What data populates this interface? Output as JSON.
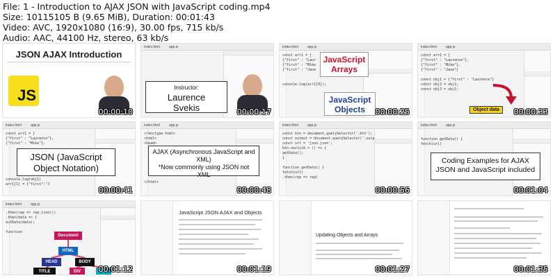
{
  "file_info": {
    "line1": "File: 1 - Introduction to AJAX JSON with JavaScript coding.mp4",
    "line2": "Size: 10115105 B (9.65 MiB), Duration: 00:01:43",
    "line3": "Video: AVC, 1920x1080 (16:9), 30.00 fps, 715 kb/s",
    "line4": "Audio: AAC, 44100 Hz, stereo, 63 kb/s"
  },
  "thumbnails": [
    {
      "timestamp": "00:00:10",
      "title": "JSON AJAX Introduction",
      "logo": "JS"
    },
    {
      "timestamp": "00:00:17",
      "instructor_label": "Instructor:",
      "instructor_name": "Laurence Svekis",
      "tab1": "index.html",
      "tab2": "app.js"
    },
    {
      "timestamp": "00:00:25",
      "word1": "JavaScript Arrays",
      "word2": "JavaScript Objects",
      "tab1": "index.html",
      "tab2": "app.js"
    },
    {
      "timestamp": "00:00:33",
      "label": "Object data",
      "tab1": "index.html",
      "tab2": "app.js"
    },
    {
      "timestamp": "00:00:41",
      "caption": "JSON (JavaScript Object Notation)",
      "tab1": "index.html",
      "tab2": "app.js"
    },
    {
      "timestamp": "00:00:48",
      "caption_a": "AJAX (Asynchronous JavaScript and XML)",
      "caption_b": "*Now commonly using JSON not XML",
      "tab1": "index.html",
      "tab2": "app.js"
    },
    {
      "timestamp": "00:00:56",
      "tab1": "index.html",
      "tab2": "app.js"
    },
    {
      "timestamp": "00:01:04",
      "caption": "Coding Examples for AJAX JSON and JavaScript included",
      "tab1": "index.html",
      "tab2": "app.js"
    },
    {
      "timestamp": "00:01:12",
      "nodes": [
        "Document",
        "HTML",
        "HEAD",
        "BODY",
        "TITLE",
        "DIV",
        "DIV"
      ],
      "tab1": "index.html",
      "tab2": "app.js"
    },
    {
      "timestamp": "00:01:19",
      "doc_title": "JavaScript JSON AJAX and Objects"
    },
    {
      "timestamp": "00:01:27",
      "doc_heading": "Updating Objects and Arrays"
    },
    {
      "timestamp": "00:01:35"
    }
  ],
  "colors": {
    "js_yellow": "#f7df1e",
    "red_accent": "#c8102e",
    "blue_accent": "#1f3f8f"
  }
}
